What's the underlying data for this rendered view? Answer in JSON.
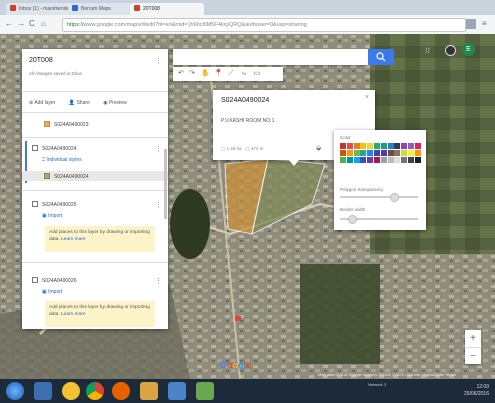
{
  "browser": {
    "tabs": [
      {
        "label": "Inbox (1) - manimender",
        "color": "#d23f31"
      },
      {
        "label": "Berrum Maps",
        "color": "#3367d6"
      },
      {
        "label": "20T008",
        "color": "#d23f31"
      }
    ],
    "url_scheme": "https://",
    "url_rest": "www.google.com/maps/d/edit?hl=en&mid=1h6bc8iM5F4kxyQRQ&authuser=0&usp=sharing"
  },
  "panel": {
    "title": "20T008",
    "subtitle": "All changes saved in Drive",
    "actions": {
      "add_layer": "Add layer",
      "share": "Share",
      "preview": "Preview"
    },
    "layer0_item": "S024A0490023",
    "layer1": {
      "name": "S024A0490024",
      "style_link": "Individual styles",
      "item": "S024A0490024"
    },
    "layer2": {
      "name": "S024A0490025",
      "import": "Import",
      "hint_text": "Add places to this layer by drawing or importing data.",
      "hint_link": "Learn more"
    },
    "layer3": {
      "name": "S024A0490026",
      "import": "Import",
      "hint_text": "Add places to this layer by drawing or importing data.",
      "hint_link": "Learn more"
    }
  },
  "infowindow": {
    "title": "S024A0490024",
    "description": "P.V.KASHI ROOM NO.1",
    "area": "1.46 ha",
    "perimeter": "474 m"
  },
  "stylepopup": {
    "color_label": "Color",
    "transparency_label": "Polygon transparency",
    "border_label": "Border width",
    "palette": [
      "#c0392b",
      "#e74c3c",
      "#e67e22",
      "#f1c40f",
      "#f4d03f",
      "#27ae60",
      "#16a085",
      "#2980b9",
      "#2c3e50",
      "#8e44ad",
      "#9b59b6",
      "#e91e63",
      "#d35400",
      "#f39c12",
      "#7cb342",
      "#26a69a",
      "#1e88e5",
      "#3949ab",
      "#5e35b1",
      "#6d4c41",
      "#8d6e63",
      "#cddc39",
      "#ffeb3b",
      "#ff9800",
      "#4caf50",
      "#009688",
      "#03a9f4",
      "#3f51b5",
      "#673ab7",
      "#ad1457",
      "#9e9e9e",
      "#bdbdbd",
      "#e0e0e0",
      "#757575",
      "#424242",
      "#212121"
    ]
  },
  "map": {
    "google_word": "Google",
    "attribution": "Map data ©2016 Google  Imagery ©2016, CNES / Astrium, DigitalGlobe  Terms",
    "zoom_in": "+",
    "zoom_out": "−"
  },
  "taskbar": {
    "time": "12:09",
    "date": "25/06/2016",
    "network": "Network 3"
  }
}
